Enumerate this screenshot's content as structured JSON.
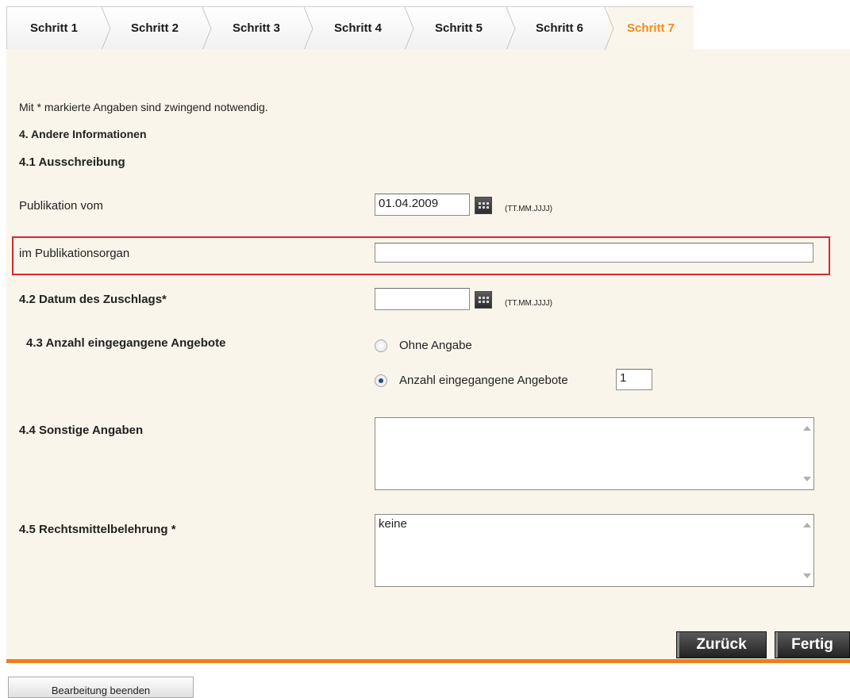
{
  "steps": [
    {
      "label": "Schritt 1",
      "active": false
    },
    {
      "label": "Schritt 2",
      "active": false
    },
    {
      "label": "Schritt 3",
      "active": false
    },
    {
      "label": "Schritt 4",
      "active": false
    },
    {
      "label": "Schritt 5",
      "active": false
    },
    {
      "label": "Schritt 6",
      "active": false
    },
    {
      "label": "Schritt 7",
      "active": true
    }
  ],
  "colors": {
    "accent": "#f08a1e",
    "highlight": "#d22a33",
    "panel": "#faf5ea"
  },
  "form": {
    "required_note": "Mit * markierte Angaben sind zwingend notwendig.",
    "section_title": "4. Andere Informationen",
    "subsection_41": "4.1 Ausschreibung",
    "publication_date_label": "Publikation vom",
    "publication_date_value": "01.04.2009",
    "date_format_hint": "(TT.MM.JJJJ)",
    "publication_organ_label": "im Publikationsorgan",
    "publication_organ_value": "",
    "award_date_label": "4.2 Datum des Zuschlags*",
    "award_date_value": "",
    "offers_label": "4.3 Anzahl eingegangene Angebote",
    "radio_none_label": "Ohne Angabe",
    "radio_count_label": "Anzahl eingegangene Angebote",
    "offers_count_value": "1",
    "other_info_label": "4.4 Sonstige Angaben",
    "other_info_value": "",
    "legal_remedy_label": "4.5 Rechtsmittelbelehrung *",
    "legal_remedy_value": "keine"
  },
  "buttons": {
    "back": "Zurück",
    "finish": "Fertig",
    "end_editing": "Bearbeitung beenden"
  },
  "icons": {
    "date_picker": "calendar-icon",
    "radio": "radio-button"
  }
}
